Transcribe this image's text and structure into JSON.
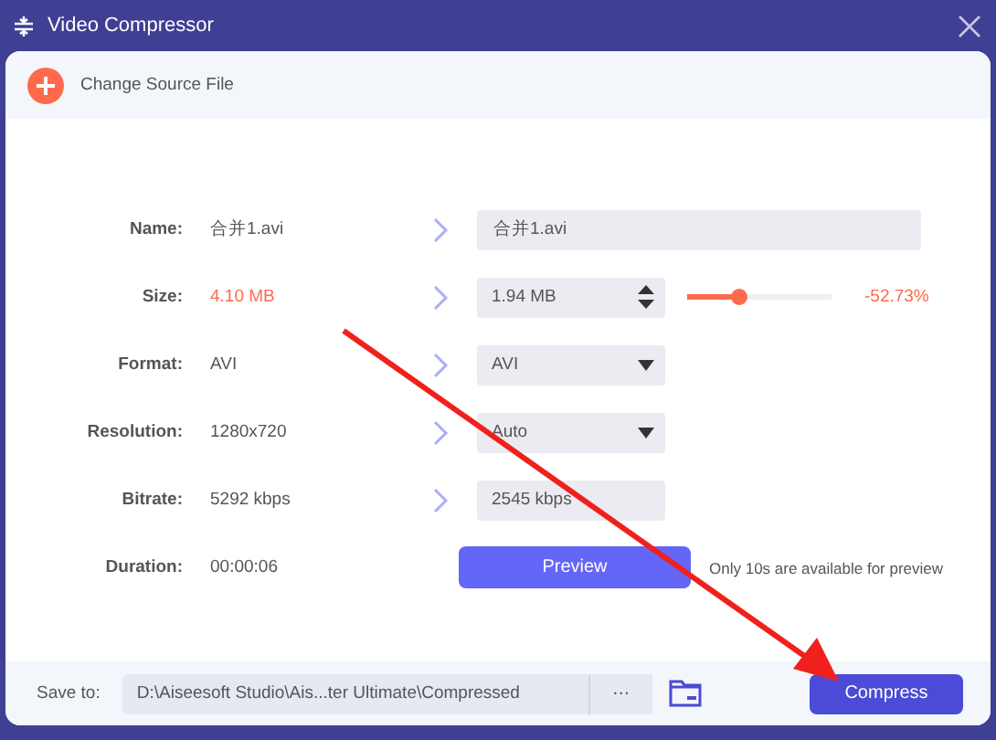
{
  "window": {
    "title": "Video Compressor"
  },
  "source": {
    "label": "Change Source File"
  },
  "rows": [
    {
      "label": "Name:",
      "value": "合并1.avi",
      "highlight": false,
      "kind": "text",
      "output": "合并1.avi"
    },
    {
      "label": "Size:",
      "value": "4.10 MB",
      "highlight": true,
      "kind": "spin",
      "output": "1.94 MB",
      "level": 0.35,
      "reading": "-52.73%"
    },
    {
      "label": "Format:",
      "value": "AVI",
      "highlight": false,
      "kind": "dropdown",
      "output": "AVI"
    },
    {
      "label": "Resolution:",
      "value": "1280x720",
      "highlight": false,
      "kind": "dropdown",
      "output": "Auto"
    },
    {
      "label": "Bitrate:",
      "value": "5292 kbps",
      "highlight": false,
      "kind": "short",
      "output": "2545 kbps"
    },
    {
      "label": "Duration:",
      "value": "00:00:06",
      "highlight": false,
      "kind": "preview",
      "output": "Preview",
      "note": "Only 10s are available for preview"
    }
  ],
  "footer": {
    "label": "Save to:",
    "path": "D:\\Aiseesoft Studio\\Ais...ter Ultimate\\Compressed",
    "more": "···",
    "button": "Compress"
  },
  "annotation": {
    "kind": "arrow"
  }
}
